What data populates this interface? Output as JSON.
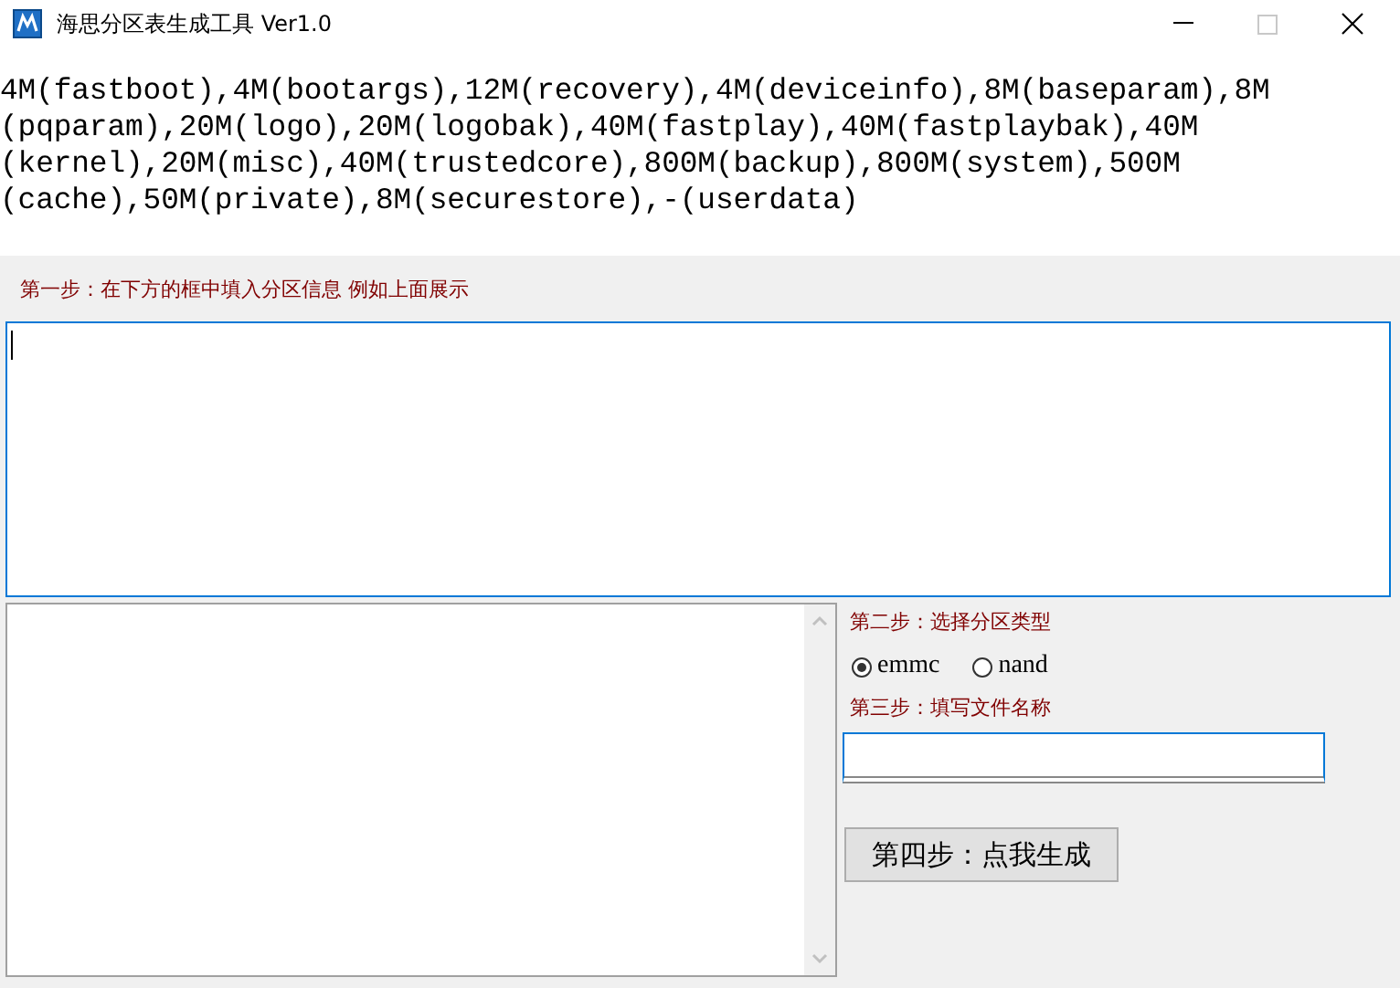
{
  "window": {
    "title": "海思分区表生成工具 Ver1.0"
  },
  "example_lines": [
    "4M(fastboot),4M(bootargs),12M(recovery),4M(deviceinfo),8M(baseparam),8M",
    "(pqparam),20M(logo),20M(logobak),40M(fastplay),40M(fastplaybak),40M",
    "(kernel),20M(misc),40M(trustedcore),800M(backup),800M(system),500M",
    "(cache),50M(private),8M(securestore),-(userdata)"
  ],
  "step1": "第一步：在下方的框中填入分区信息 例如上面展示",
  "step2": "第二步：选择分区类型",
  "partition_types": [
    {
      "label": "emmc",
      "selected": true
    },
    {
      "label": "nand",
      "selected": false
    }
  ],
  "step3": "第三步：填写文件名称",
  "generate_button": "第四步：点我生成"
}
